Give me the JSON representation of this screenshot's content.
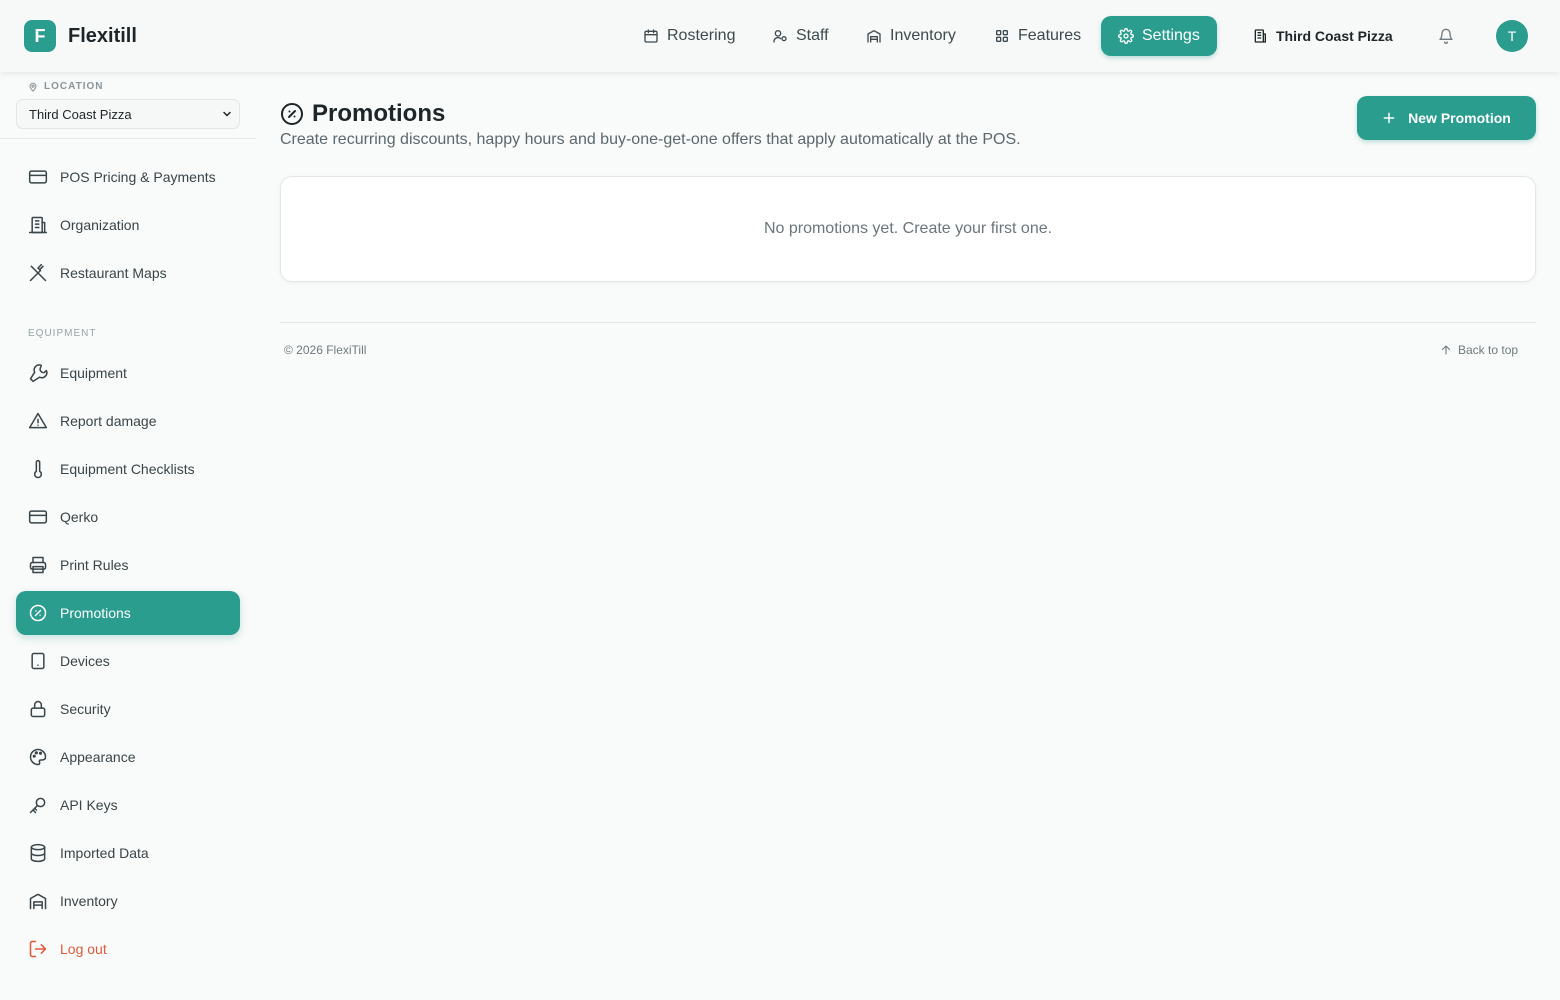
{
  "app": {
    "name": "Flexitill",
    "logo_letter": "F",
    "accent_color": "#2a9d8f"
  },
  "topnav": {
    "items": [
      {
        "label": "Rostering",
        "icon": "calendar-icon"
      },
      {
        "label": "Staff",
        "icon": "users-icon"
      },
      {
        "label": "Inventory",
        "icon": "warehouse-icon"
      },
      {
        "label": "Features",
        "icon": "grid-icon"
      },
      {
        "label": "Settings",
        "icon": "gear-icon",
        "active": true
      }
    ],
    "location_name": "Third Coast Pizza",
    "avatar_initial": "T"
  },
  "sidebar": {
    "location_label": "LOCATION",
    "location_value": "Third Coast Pizza",
    "items": [
      {
        "label": "POS Pricing & Payments",
        "icon": "credit-card-icon"
      },
      {
        "label": "Organization",
        "icon": "building-icon"
      },
      {
        "label": "Restaurant Maps",
        "icon": "utensils-crossed-icon"
      }
    ],
    "equipment_label": "EQUIPMENT",
    "equipment_items": [
      {
        "label": "Equipment",
        "icon": "wrench-icon"
      },
      {
        "label": "Report damage",
        "icon": "warning-triangle-icon"
      },
      {
        "label": "Equipment Checklists",
        "icon": "thermometer-icon"
      },
      {
        "label": "Qerko",
        "icon": "credit-card-icon"
      },
      {
        "label": "Print Rules",
        "icon": "printer-icon"
      },
      {
        "label": "Promotions",
        "icon": "badge-percent-icon",
        "active": true
      },
      {
        "label": "Devices",
        "icon": "tablet-icon"
      },
      {
        "label": "Security",
        "icon": "lock-icon"
      },
      {
        "label": "Appearance",
        "icon": "palette-icon"
      },
      {
        "label": "API Keys",
        "icon": "key-icon"
      },
      {
        "label": "Imported Data",
        "icon": "database-icon"
      },
      {
        "label": "Inventory",
        "icon": "warehouse-icon"
      }
    ],
    "logout_label": "Log out"
  },
  "main": {
    "title": "Promotions",
    "subtitle": "Create recurring discounts, happy hours and buy-one-get-one offers that apply automatically at the POS.",
    "new_button_label": "New Promotion",
    "empty_message": "No promotions yet. Create your first one."
  },
  "footer": {
    "copyright": "© 2026 FlexiTill",
    "back_to_top": "Back to top"
  }
}
